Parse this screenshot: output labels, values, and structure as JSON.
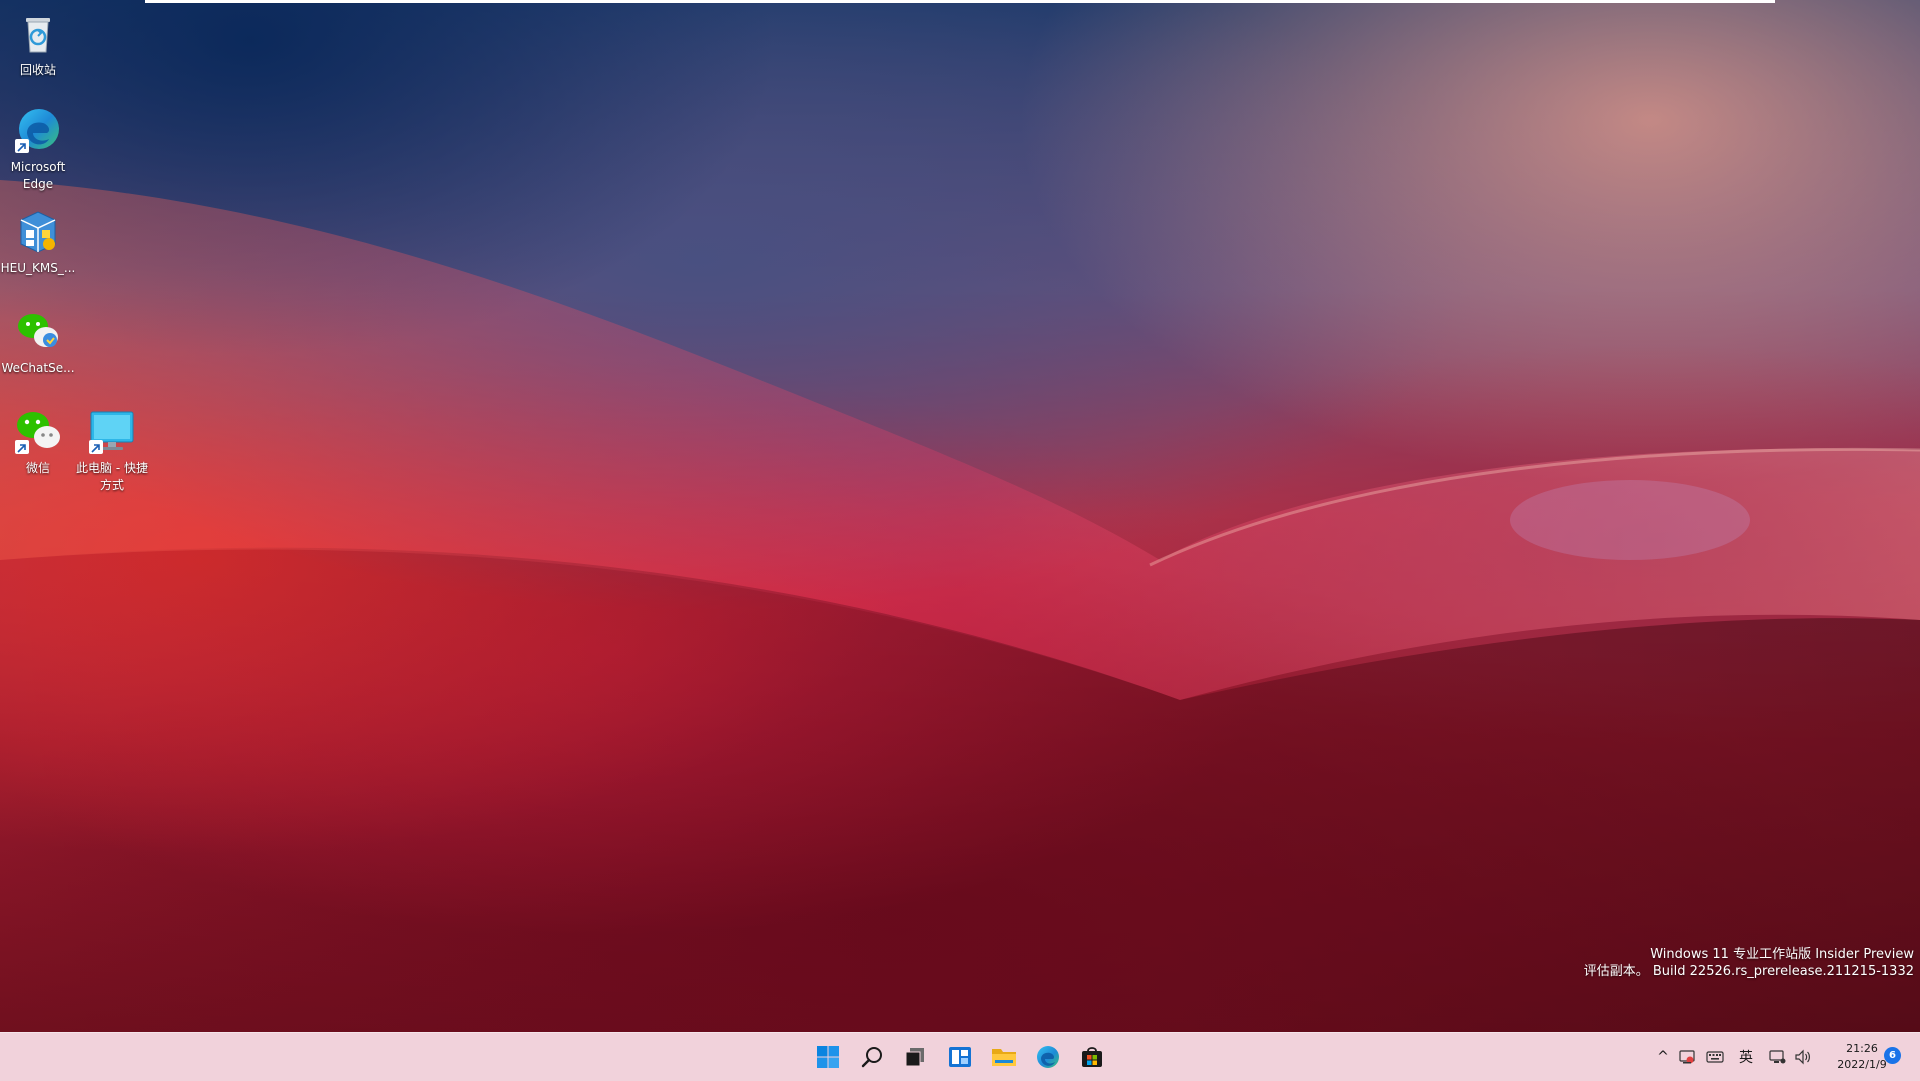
{
  "desktop": {
    "icons": [
      {
        "label": "回收站",
        "icon": "recycle-bin-icon"
      },
      {
        "label": "Microsoft Edge",
        "icon": "edge-icon"
      },
      {
        "label": "HEU_KMS_...",
        "icon": "kms-tool-icon"
      },
      {
        "label": "WeChatSe...",
        "icon": "wechat-setup-icon"
      },
      {
        "label": "微信",
        "icon": "wechat-icon"
      },
      {
        "label": "此电脑 - 快捷方式",
        "icon": "this-pc-icon"
      }
    ],
    "watermark": {
      "line1": "Windows 11 专业工作站版 Insider Preview",
      "line2": "评估副本。 Build 22526.rs_prerelease.211215-1332"
    }
  },
  "taskbar": {
    "apps": [
      "start-icon",
      "search-icon",
      "task-view-icon",
      "widgets-icon",
      "file-explorer-icon",
      "edge-icon",
      "store-icon"
    ],
    "tray": {
      "chevron": "^",
      "language": "英"
    },
    "clock": {
      "time": "21:26",
      "date": "2022/1/9"
    },
    "notification_count": "6"
  },
  "colors": {
    "taskbar_bg": "#f1d2db",
    "accent_blue": "#0078d4"
  }
}
